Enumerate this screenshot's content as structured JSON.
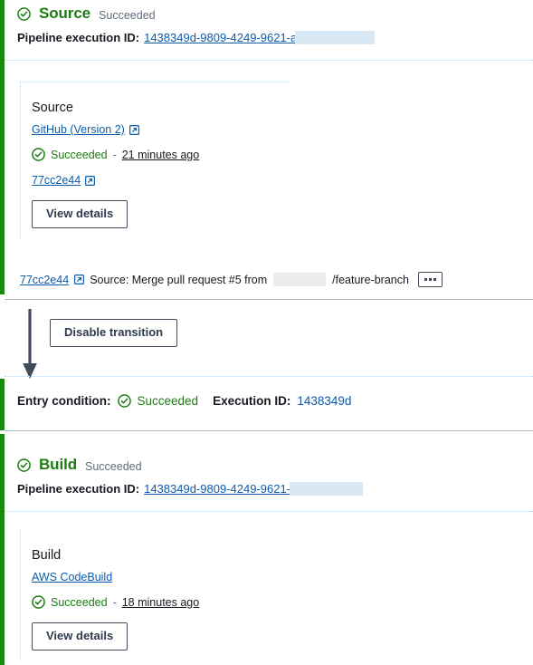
{
  "colors": {
    "stage_bar_green": "#1a8a0f",
    "heading_green": "#1c7c11",
    "link_blue": "#0d5bab",
    "text_dark": "#16191f",
    "muted_grey": "#5f6b7a",
    "redact_blue": "#d8e8f5"
  },
  "source_stage": {
    "status_icon": "check-circle-icon",
    "title": "Source",
    "status": "Succeeded",
    "exec_label": "Pipeline execution ID:",
    "exec_id": "1438349d-9809-4249-9621-a",
    "action": {
      "name": "Source",
      "provider": "GitHub (Version 2)",
      "provider_icon": "external-link-icon",
      "status": "Succeeded",
      "separator": "-",
      "time": "21 minutes ago",
      "commit_id": "77cc2e44",
      "commit_icon": "external-link-icon",
      "button": "View details"
    },
    "commit_row": {
      "commit_id": "77cc2e44",
      "commit_icon": "external-link-icon",
      "message_prefix": "Source: Merge pull request #5 from",
      "message_suffix": "/feature-branch",
      "menu_icon": "kebab-menu-icon"
    }
  },
  "transition": {
    "arrow_icon": "down-arrow-icon",
    "button": "Disable transition"
  },
  "entry_condition": {
    "label": "Entry condition:",
    "status_icon": "check-circle-icon",
    "status": "Succeeded",
    "exec_label": "Execution ID:",
    "exec_id": "1438349d"
  },
  "build_stage": {
    "status_icon": "check-circle-icon",
    "title": "Build",
    "status": "Succeeded",
    "exec_label": "Pipeline execution ID:",
    "exec_id": "1438349d-9809-4249-9621-",
    "action": {
      "name": "Build",
      "provider": "AWS CodeBuild",
      "status": "Succeeded",
      "separator": "-",
      "time": "18 minutes ago",
      "button": "View details"
    }
  }
}
